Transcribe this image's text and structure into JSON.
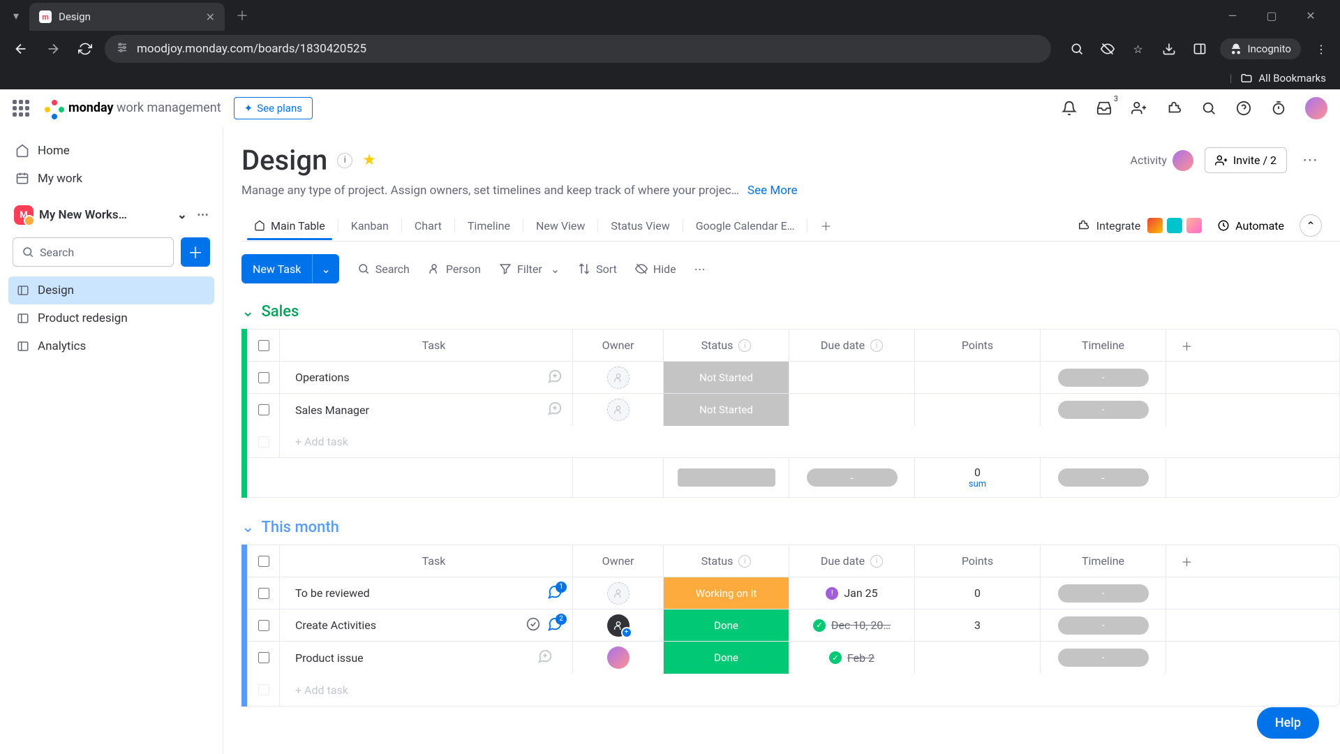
{
  "browser": {
    "tab_title": "Design",
    "url": "moodjoy.monday.com/boards/1830420525",
    "incognito_label": "Incognito",
    "bookmarks_label": "All Bookmarks"
  },
  "app_header": {
    "brand_bold": "monday",
    "brand_rest": " work management",
    "see_plans": "See plans",
    "inbox_badge": "3"
  },
  "sidebar": {
    "home": "Home",
    "my_work": "My work",
    "workspace": "My New Works…",
    "search_placeholder": "Search",
    "boards": [
      {
        "label": "Design",
        "active": true
      },
      {
        "label": "Product redesign",
        "active": false
      },
      {
        "label": "Analytics",
        "active": false
      }
    ]
  },
  "board": {
    "title": "Design",
    "description": "Manage any type of project. Assign owners, set timelines and keep track of where your projec…",
    "see_more": "See More",
    "activity_label": "Activity",
    "invite_label": "Invite / 2",
    "views": [
      "Main Table",
      "Kanban",
      "Chart",
      "Timeline",
      "New View",
      "Status View",
      "Google Calendar E…"
    ],
    "integrate": "Integrate",
    "automate": "Automate"
  },
  "toolbar": {
    "new_task": "New Task",
    "search": "Search",
    "person": "Person",
    "filter": "Filter",
    "sort": "Sort",
    "hide": "Hide"
  },
  "columns": {
    "task": "Task",
    "owner": "Owner",
    "status": "Status",
    "due": "Due date",
    "points": "Points",
    "timeline": "Timeline"
  },
  "groups": {
    "sales": {
      "title": "Sales",
      "rows": [
        {
          "task": "Operations",
          "status": "Not Started",
          "status_class": "status-notstarted"
        },
        {
          "task": "Sales Manager",
          "status": "Not Started",
          "status_class": "status-notstarted"
        }
      ],
      "add_task": "+ Add task",
      "points_sum": "0",
      "points_sum_label": "sum",
      "timeline_dash": "-",
      "due_dash": "-"
    },
    "this_month": {
      "title": "This month",
      "rows": [
        {
          "task": "To be reviewed",
          "status": "Working on it",
          "status_class": "status-working",
          "due": "Jan 25",
          "due_icon": "purple",
          "points": "0",
          "chat": "1"
        },
        {
          "task": "Create Activities",
          "status": "Done",
          "status_class": "status-done",
          "due": "Dec 10, 20…",
          "due_icon": "green",
          "due_strike": true,
          "points": "3",
          "chat": "2",
          "checked_icon": true,
          "owner": "black"
        },
        {
          "task": "Product issue",
          "status": "Done",
          "status_class": "status-done",
          "due": "Feb 2",
          "due_icon": "green",
          "due_strike": true,
          "owner": "avatar"
        }
      ],
      "add_task": "+ Add task"
    }
  },
  "help": "Help",
  "dash": "-"
}
